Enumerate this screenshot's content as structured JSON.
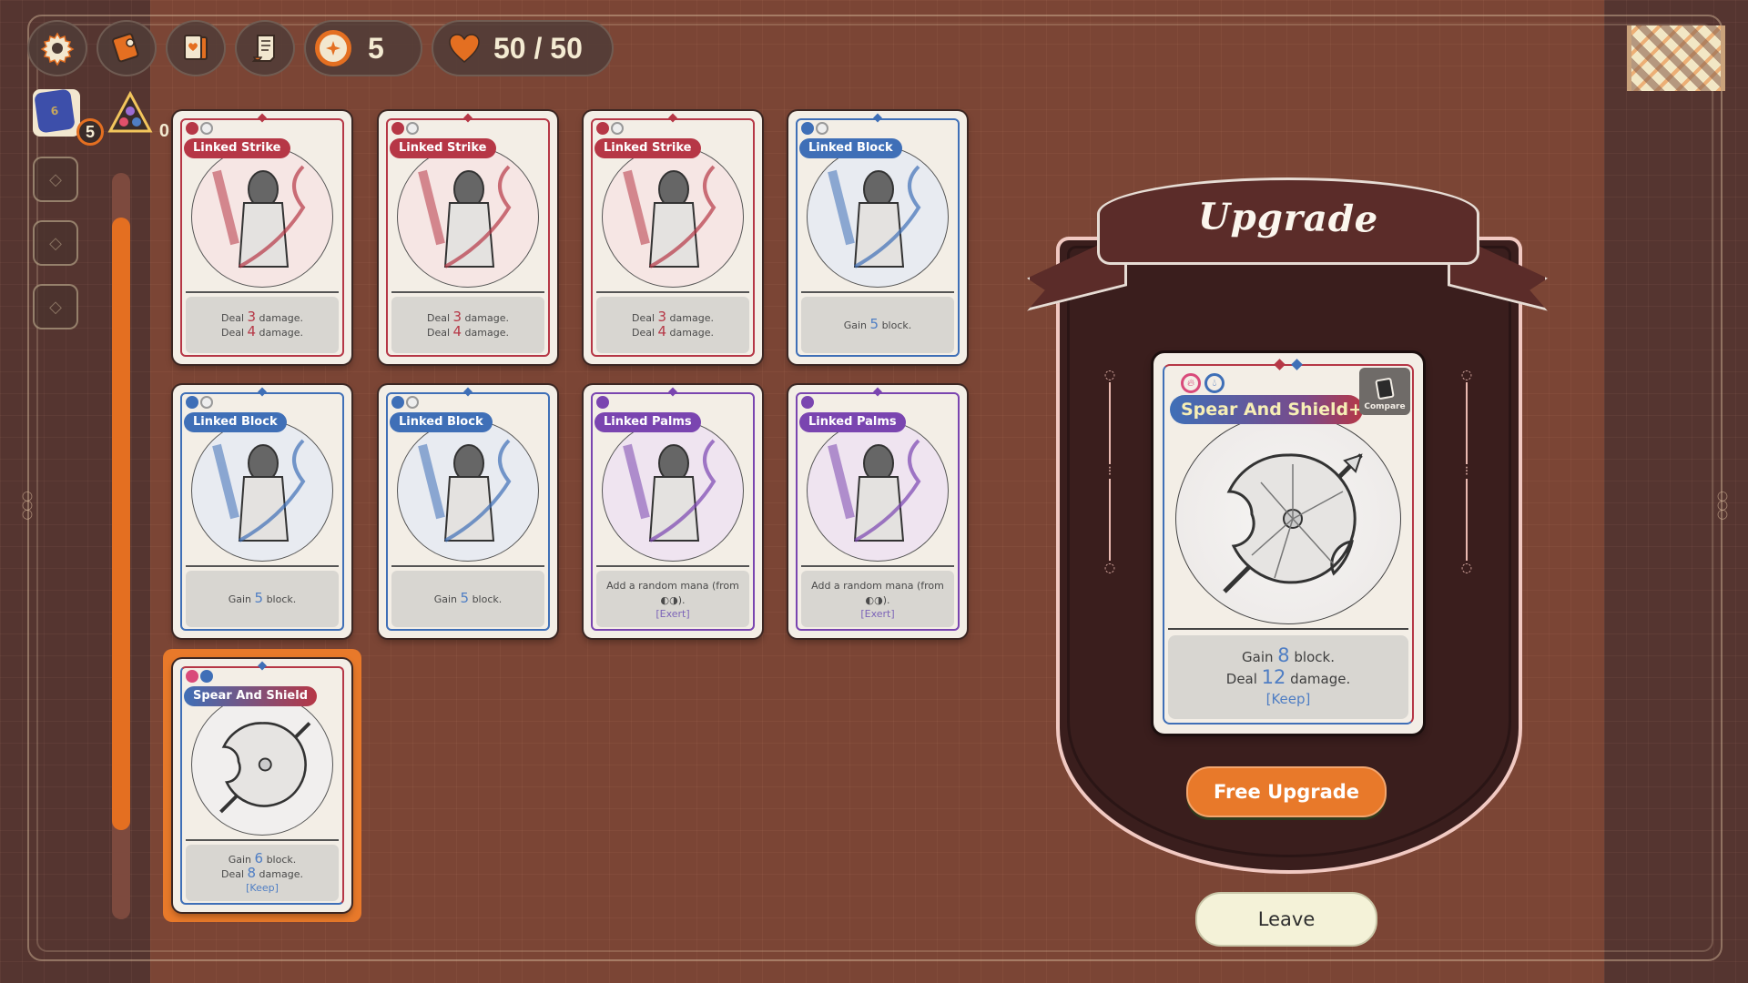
{
  "topbar": {
    "buttons": [
      {
        "name": "settings",
        "icon": "gear-icon"
      },
      {
        "name": "map-journal",
        "icon": "journal-icon"
      },
      {
        "name": "deck",
        "icon": "deck-icon"
      },
      {
        "name": "quest-log",
        "icon": "scroll-icon"
      }
    ],
    "gold": "5",
    "hp": "50 / 50"
  },
  "resources": {
    "dice_count": "5",
    "prism_count": "0"
  },
  "scroll": {
    "position": 0.06,
    "visible_fraction": 0.82
  },
  "colors": {
    "red": "#b63746",
    "blue": "#3f6fb7",
    "purple": "#7a45b0",
    "accent": "#e8792a",
    "panel": "#3a1e1d"
  },
  "cards": [
    {
      "title": "Linked Strike",
      "color": "red",
      "lines": [
        [
          "Deal ",
          "3",
          " damage."
        ],
        [
          "Deal ",
          "4",
          " damage."
        ]
      ],
      "keyword": ""
    },
    {
      "title": "Linked Strike",
      "color": "red",
      "lines": [
        [
          "Deal ",
          "3",
          " damage."
        ],
        [
          "Deal ",
          "4",
          " damage."
        ]
      ],
      "keyword": ""
    },
    {
      "title": "Linked Strike",
      "color": "red",
      "lines": [
        [
          "Deal ",
          "3",
          " damage."
        ],
        [
          "Deal ",
          "4",
          " damage."
        ]
      ],
      "keyword": ""
    },
    {
      "title": "Linked Block",
      "color": "blue",
      "lines": [
        [
          "Gain ",
          "5",
          " block."
        ]
      ],
      "keyword": ""
    },
    {
      "title": "Linked Block",
      "color": "blue",
      "lines": [
        [
          "Gain ",
          "5",
          " block."
        ]
      ],
      "keyword": ""
    },
    {
      "title": "Linked Block",
      "color": "blue",
      "lines": [
        [
          "Gain ",
          "5",
          " block."
        ]
      ],
      "keyword": ""
    },
    {
      "title": "Linked Palms",
      "color": "purple",
      "lines": [
        [
          "Add a random mana (from",
          "",
          ""
        ],
        [
          "",
          "",
          "◐◑)."
        ]
      ],
      "keyword": "[Exert]"
    },
    {
      "title": "Linked Palms",
      "color": "purple",
      "lines": [
        [
          "Add a random mana (from",
          "",
          ""
        ],
        [
          "",
          "",
          "◐◑)."
        ]
      ],
      "keyword": "[Exert]"
    },
    {
      "title": "Spear And Shield",
      "color": "dual",
      "lines": [
        [
          "Gain ",
          "6",
          " block."
        ],
        [
          "Deal ",
          "8",
          " damage."
        ]
      ],
      "keyword": "[Keep]",
      "selected": true
    }
  ],
  "upgrade": {
    "title": "Upgrade",
    "card": {
      "title": "Spear And Shield+",
      "line1_pre": "Gain ",
      "line1_num": "8",
      "line1_post": " block.",
      "line2_pre": "Deal ",
      "line2_num": "12",
      "line2_post": " damage.",
      "keyword": "[Keep]"
    },
    "compare_label": "Compare",
    "free_upgrade_label": "Free Upgrade",
    "leave_label": "Leave"
  }
}
